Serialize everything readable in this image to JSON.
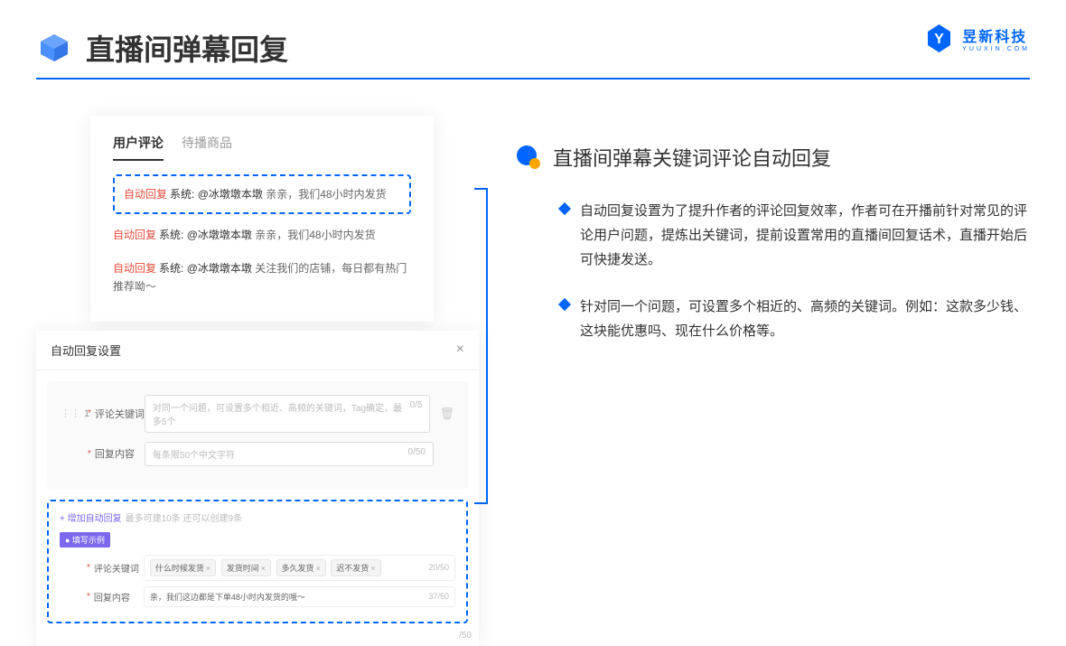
{
  "header": {
    "title": "直播间弹幕回复"
  },
  "logo": {
    "main": "昱新科技",
    "sub": "YUUXIN.COM"
  },
  "comments": {
    "tabs": [
      "用户评论",
      "待播商品"
    ],
    "items": [
      {
        "auto": "自动回复",
        "sys": "系统:",
        "mention": "@冰墩墩本墩",
        "text": " 亲亲，我们48小时内发货",
        "hl": true
      },
      {
        "auto": "自动回复",
        "sys": "系统:",
        "mention": "@冰墩墩本墩",
        "text": " 亲亲，我们48小时内发货",
        "hl": false
      },
      {
        "auto": "自动回复",
        "sys": "系统:",
        "mention": "@冰墩墩本墩",
        "text": " 关注我们的店铺，每日都有热门推荐呦～",
        "hl": false
      }
    ]
  },
  "settings": {
    "title": "自动回复设置",
    "index": "1",
    "keyword_label": "评论关键词",
    "keyword_placeholder": "对同一个问题，可设置多个相近、高频的关键词，Tag确定，最多5个",
    "keyword_counter": "0/5",
    "content_label": "回复内容",
    "content_placeholder": "每条限50个中文字符",
    "content_counter": "0/50",
    "add_text": "+ 增加自动回复",
    "add_hint": "最多可建10条 还可以创建9条",
    "example_badge": "● 填写示例",
    "ex_keyword_label": "评论关键词",
    "ex_tags": [
      "什么时候发货",
      "发货时间",
      "多久发货",
      "迟不发货"
    ],
    "ex_keyword_counter": "20/50",
    "ex_content_label": "回复内容",
    "ex_content_text": "亲，我们这边都是下单48小时内发货的哦～",
    "ex_content_counter": "37/50",
    "outer_counter": "/50"
  },
  "feature": {
    "title": "直播间弹幕关键词评论自动回复",
    "bullets": [
      "自动回复设置为了提升作者的评论回复效率，作者可在开播前针对常见的评论用户问题，提炼出关键词，提前设置常用的直播间回复话术，直播开始后可快捷发送。",
      "针对同一个问题，可设置多个相近的、高频的关键词。例如：这款多少钱、这块能优惠吗、现在什么价格等。"
    ]
  }
}
